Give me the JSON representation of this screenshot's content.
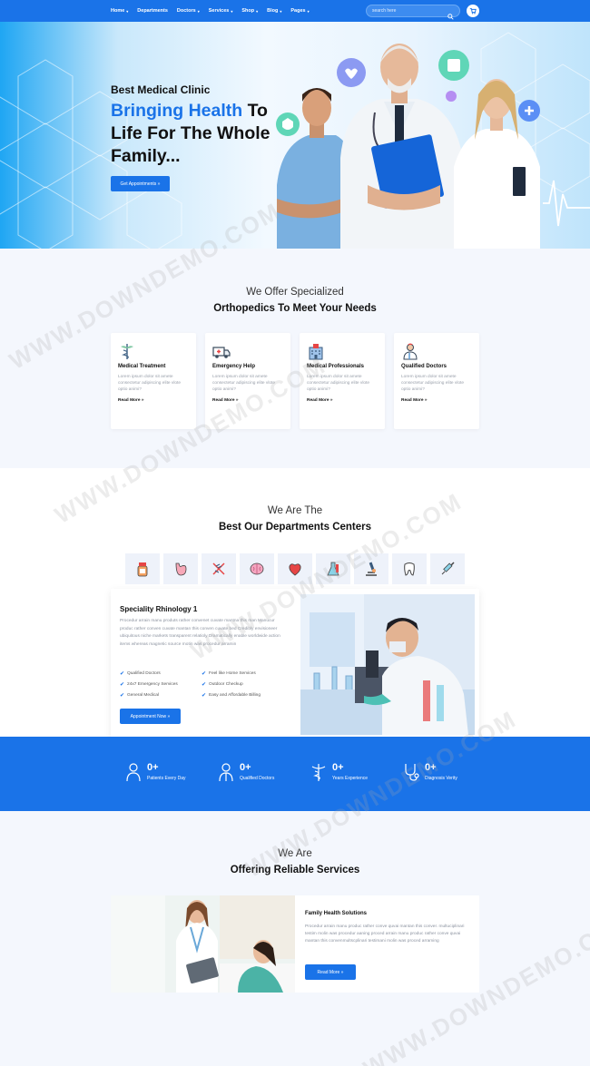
{
  "nav": {
    "items": [
      "Home",
      "Departments",
      "Doctors",
      "Services",
      "Shop",
      "Blog",
      "Pages"
    ],
    "search_placeholder": "search here"
  },
  "hero": {
    "subtitle": "Best Medical Clinic",
    "title_highlight": "Bringing Health",
    "title_rest": " To Life For The Whole Family...",
    "button": "Get Appointments »"
  },
  "offer": {
    "kicker": "We Offer Specialized",
    "title": "Orthopedics To Meet Your Needs",
    "cards": [
      {
        "icon": "caduceus-icon",
        "title": "Medical Treatment",
        "body": "Lorem ipsum dolor sit amete consectetur adipiscing elite vlote optio animi?",
        "link": "Read More »"
      },
      {
        "icon": "ambulance-icon",
        "title": "Emergency Help",
        "body": "Lorem ipsum dolor sit amete consectetur adipiscing elite vlote optio animi?",
        "link": "Read More »"
      },
      {
        "icon": "hospital-icon",
        "title": "Medical Professionals",
        "body": "Lorem ipsum dolor sit amete consectetur adipiscing elite vlote optio animi?",
        "link": "Read More »"
      },
      {
        "icon": "doctor-icon",
        "title": "Qualified Doctors",
        "body": "Lorem ipsum dolor sit amete consectetur adipiscing elite vlote optio animi?",
        "link": "Read More »"
      }
    ]
  },
  "departments": {
    "kicker": "We Are The",
    "title": "Best Our Departments Centers",
    "tabs": [
      "medicine-icon",
      "stomach-icon",
      "dna-icon",
      "brain-icon",
      "heart-icon",
      "lab-flask-icon",
      "microscope-icon",
      "tooth-icon",
      "syringe-icon"
    ],
    "panel": {
      "title": "Speciality Rhinology 1",
      "body": "Procedur arrain manu produts rather convenet cuvate mantna this man Manucur produc rather conven cuvate mantan this conven cuvate bed Credibly envisioneer ubiquitous niche markets transparent relatioly Dramatically enable worldwide action items whereas magnetic source motin was procedur arramin",
      "checks": [
        "Qualified Doctors",
        "Feel like Home Services",
        "24x7 Emergency Services",
        "Outdoor Checkup",
        "General Medical",
        "Easy and Affordable Billing"
      ],
      "button": "Appointment Now »"
    }
  },
  "stats": [
    {
      "icon": "patients-icon",
      "value": "0+",
      "label": "Patients Every Day"
    },
    {
      "icon": "qualified-doctor-icon",
      "value": "0+",
      "label": "Qualified Doctors"
    },
    {
      "icon": "caduceus-icon",
      "value": "0+",
      "label": "Years Experience"
    },
    {
      "icon": "stethoscope-icon",
      "value": "0+",
      "label": "Diagnosis Verity"
    }
  ],
  "services": {
    "kicker": "We Are",
    "title": "Offering Reliable Services",
    "card_title": "Family Health Solutions",
    "card_body": "Procedur arrain manu produc rather conve quvai mantan this conver. multuciplinari testim molin was procedur aaning proced arrain manu produc rather conve quvai mantan this convenmultscplinari testimani molin was proced arraming",
    "button": "Read More »"
  },
  "watermark": "WWW.DOWNDEMO.COM",
  "colors": {
    "primary": "#1a73e8",
    "background": "#f4f7fd"
  }
}
